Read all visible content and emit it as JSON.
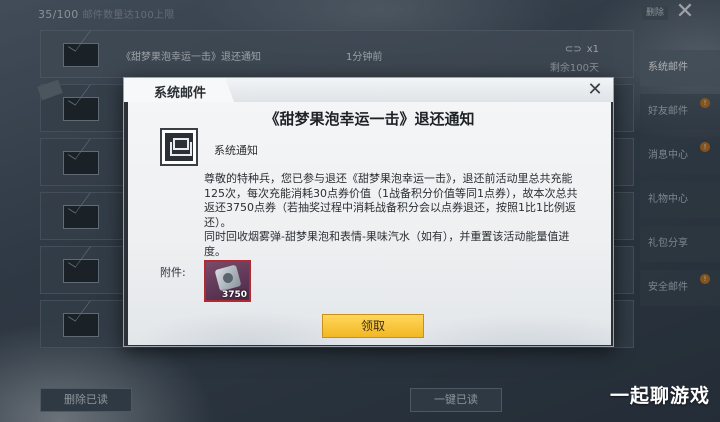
{
  "background": {
    "counter": "35/100",
    "counter_note": "邮件数量达100上限",
    "top_button": "删除",
    "mail_rows": [
      {
        "subject": "《甜梦果泡幸运一击》退还通知",
        "time": "1分钟前",
        "reward": "x1",
        "expire": "剩余100天",
        "is_new": false
      },
      {
        "subject": "",
        "time": "",
        "reward": "",
        "expire": "",
        "is_new": true
      },
      {
        "subject": "",
        "time": "",
        "reward": "",
        "expire": "",
        "is_new": false
      },
      {
        "subject": "",
        "time": "",
        "reward": "",
        "expire": "",
        "is_new": false
      },
      {
        "subject": "",
        "time": "",
        "reward": "",
        "expire": "",
        "is_new": false
      },
      {
        "subject": "",
        "time": "",
        "reward": "",
        "expire": "",
        "is_new": false
      }
    ],
    "bottom_left_button": "删除已读",
    "bottom_right_button": "一键已读",
    "side_menu": [
      {
        "label": "系统邮件",
        "badge": ""
      },
      {
        "label": "好友邮件",
        "badge": "!"
      },
      {
        "label": "消息中心",
        "badge": "!"
      },
      {
        "label": "礼物中心",
        "badge": ""
      },
      {
        "label": "礼包分享",
        "badge": ""
      },
      {
        "label": "安全邮件",
        "badge": "!"
      }
    ]
  },
  "modal": {
    "title": "系统邮件",
    "mail_heading": "《甜梦果泡幸运一击》退还通知",
    "sender": "系统通知",
    "body_lines": [
      "尊敬的特种兵，您已参与退还《甜梦果泡幸运一击》，退还前活动里总共充能125次，每次充能消耗30点券价值（1战备积分价值等同1点券），故本次总共返还3750点券（若抽奖过程中消耗战备积分会以点券退还，按照1比1比例返还）。",
      "同时回收烟雾弹-甜梦果泡和表情-果味汽水（如有），并重置该活动能量值进度。"
    ],
    "attachment_label": "附件:",
    "attachment_qty": "3750",
    "claim_button": "领取"
  },
  "watermark": "一起聊游戏"
}
